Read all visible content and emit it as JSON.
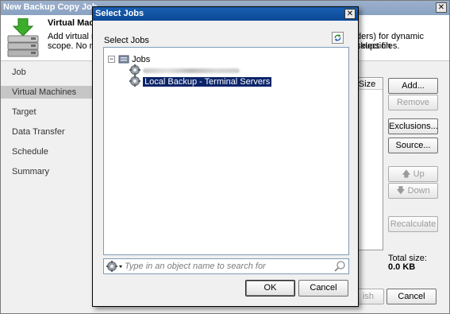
{
  "wizard": {
    "title": "New Backup Copy Job",
    "close_glyph": "✕",
    "header": {
      "title": "Virtual Mach",
      "desc_line1": "Add virtual ma",
      "desc_line2": "scope. No ma",
      "desc_right1": "ders) for dynamic selection",
      "desc_right2": "ckups files."
    },
    "nav": [
      "Job",
      "Virtual Machines",
      "Target",
      "Data Transfer",
      "Schedule",
      "Summary"
    ],
    "active_nav": "Virtual Machines",
    "list_column": "Size",
    "buttons": {
      "add": "Add...",
      "remove": "Remove",
      "exclusions": "Exclusions...",
      "source": "Source...",
      "up": "Up",
      "down": "Down",
      "recalculate": "Recalculate"
    },
    "total_label": "Total size:",
    "total_value": "0.0 KB",
    "finish": "ish",
    "cancel": "Cancel"
  },
  "dialog": {
    "title": "Select Jobs",
    "close_glyph": "✕",
    "label": "Select Jobs",
    "tree": {
      "root": "Jobs",
      "items": [
        "Local Backup - Terminal Servers"
      ]
    },
    "search_placeholder": "Type in an object name to search for",
    "ok": "OK",
    "cancel": "Cancel"
  },
  "colors": {
    "dialog_titlebar": "#0a4896",
    "selection": "#0a246a"
  }
}
